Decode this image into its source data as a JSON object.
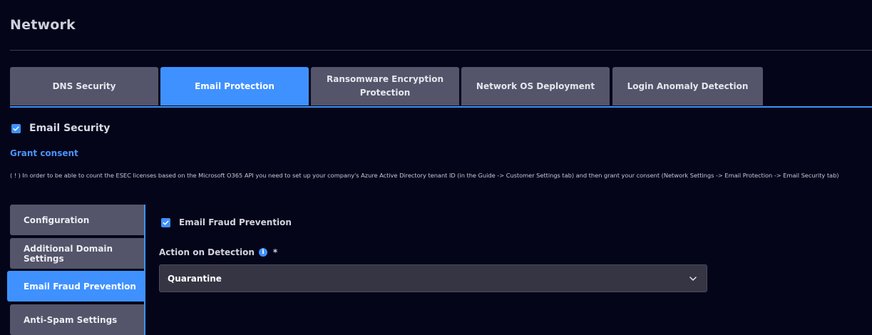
{
  "page": {
    "title": "Network"
  },
  "tabs": [
    {
      "label": "DNS Security",
      "active": false
    },
    {
      "label": "Email Protection",
      "active": true
    },
    {
      "label": "Ransomware Encryption Protection",
      "active": false
    },
    {
      "label": "Network OS Deployment",
      "active": false
    },
    {
      "label": "Login Anomaly Detection",
      "active": false
    }
  ],
  "email_security": {
    "label": "Email Security",
    "checked": true
  },
  "grant_consent": {
    "label": "Grant consent"
  },
  "consent_note": "( ! ) In order to be able to count the ESEC licenses based on the Microsoft O365 API you need to set up your company's Azure Active Directory tenant ID (in the Guide -> Customer Settings tab) and then grant your consent (Network Settings -> Email Protection -> Email Security tab)",
  "sidenav": {
    "items": [
      {
        "label": "Configuration",
        "active": false
      },
      {
        "label": "Additional Domain Settings",
        "active": false
      },
      {
        "label": "Email Fraud Prevention",
        "active": true
      },
      {
        "label": "Anti-Spam Settings",
        "active": false
      }
    ]
  },
  "content": {
    "fraud_prevention": {
      "label": "Email Fraud Prevention",
      "checked": true
    },
    "action_on_detection": {
      "label": "Action on Detection",
      "required_mark": "*",
      "info_icon_glyph": "i",
      "value": "Quarantine"
    }
  },
  "colors": {
    "background": "#05051a",
    "accent": "#3f91ff",
    "tab_inactive": "#54546a",
    "select_background": "#353544"
  },
  "icons": [
    "check-icon",
    "info-icon",
    "chevron-down-icon"
  ]
}
